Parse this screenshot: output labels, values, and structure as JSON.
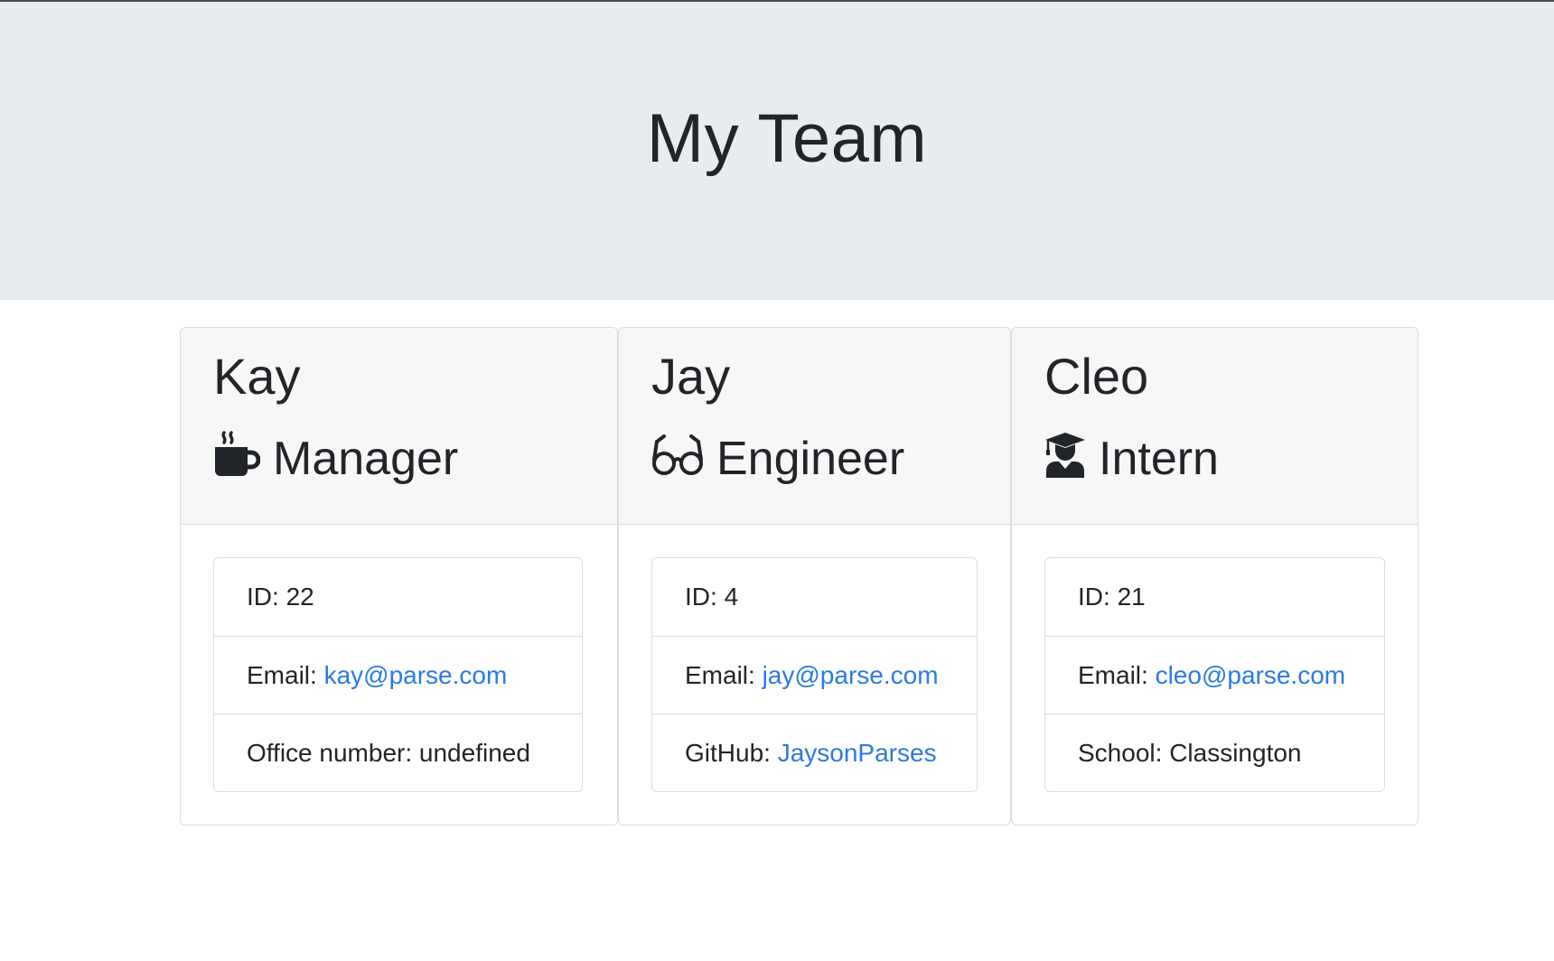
{
  "header": {
    "title": "My Team"
  },
  "accent_color": "#2a7be4",
  "employees": [
    {
      "name": "Kay",
      "role": "Manager",
      "role_icon": "mug-hot-icon",
      "id_label": "ID:",
      "id": "22",
      "email_label": "Email:",
      "email": "kay@parse.com",
      "extra_label": "Office number:",
      "extra_value": "undefined"
    },
    {
      "name": "Jay",
      "role": "Engineer",
      "role_icon": "glasses-icon",
      "id_label": "ID:",
      "id": "4",
      "email_label": "Email:",
      "email": "jay@parse.com",
      "extra_label": "GitHub:",
      "extra_value": "JaysonParses"
    },
    {
      "name": "Cleo",
      "role": "Intern",
      "role_icon": "user-graduate-icon",
      "id_label": "ID:",
      "id": "21",
      "email_label": "Email:",
      "email": "cleo@parse.com",
      "extra_label": "School:",
      "extra_value": "Classington"
    }
  ]
}
